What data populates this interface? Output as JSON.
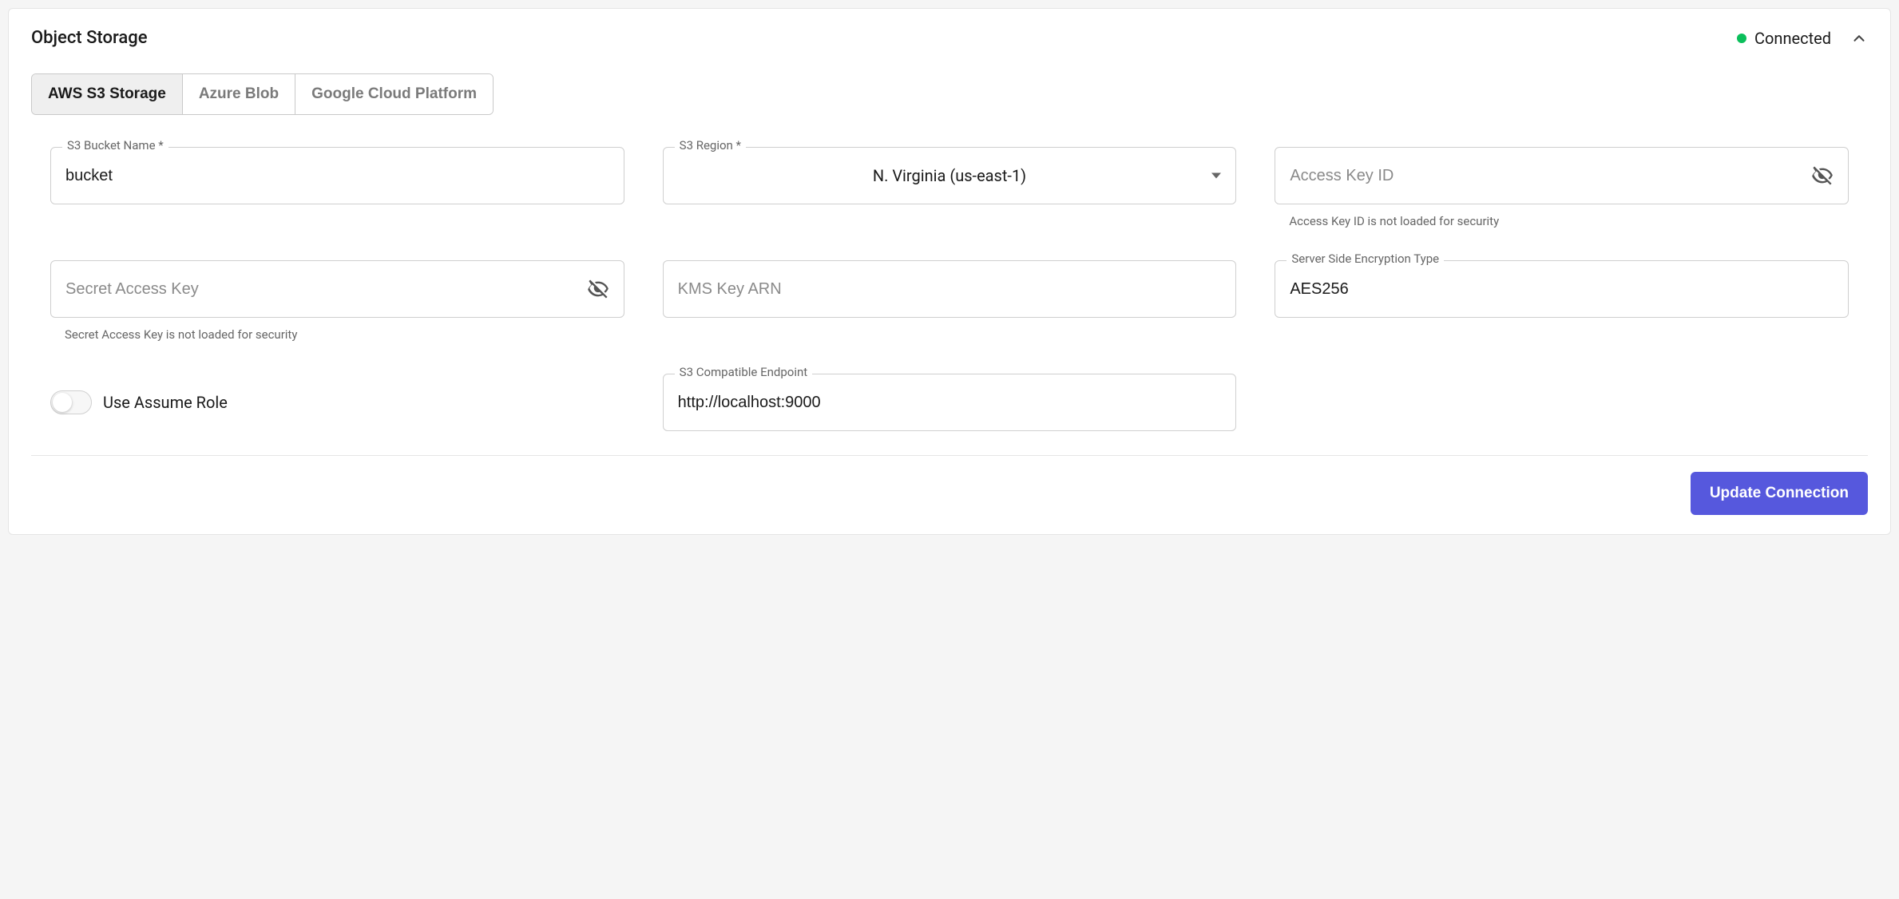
{
  "header": {
    "title": "Object Storage",
    "status_label": "Connected"
  },
  "tabs": [
    {
      "label": "AWS S3 Storage",
      "active": true
    },
    {
      "label": "Azure Blob",
      "active": false
    },
    {
      "label": "Google Cloud Platform",
      "active": false
    }
  ],
  "fields": {
    "bucket": {
      "label": "S3 Bucket Name *",
      "value": "bucket"
    },
    "region": {
      "label": "S3 Region *",
      "value": "N. Virginia (us-east-1)"
    },
    "access_key": {
      "placeholder": "Access Key ID",
      "helper": "Access Key ID is not loaded for security"
    },
    "secret_key": {
      "placeholder": "Secret Access Key",
      "helper": "Secret Access Key is not loaded for security"
    },
    "kms": {
      "placeholder": "KMS Key ARN"
    },
    "sse": {
      "label": "Server Side Encryption Type",
      "value": "AES256"
    },
    "assume_role": {
      "label": "Use Assume Role",
      "enabled": false
    },
    "endpoint": {
      "label": "S3 Compatible Endpoint",
      "value": "http://localhost:9000"
    }
  },
  "buttons": {
    "update": "Update Connection"
  }
}
